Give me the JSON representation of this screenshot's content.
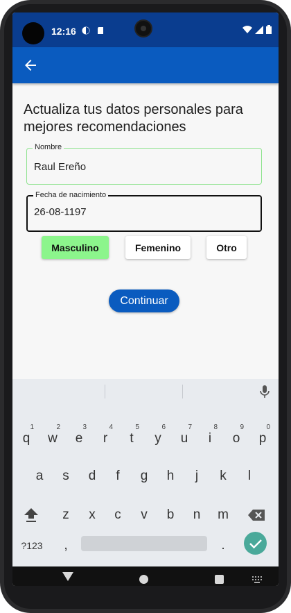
{
  "status": {
    "time": "12:16"
  },
  "header": {
    "back_icon": "arrow-back-icon"
  },
  "main": {
    "title": "Actualiza tus datos personales para mejores recomendaciones",
    "name_field": {
      "label": "Nombre",
      "value": "Raul Ereño"
    },
    "date_field": {
      "label": "Fecha de nacimiento",
      "value": "26-08-1197"
    },
    "gender_options": [
      "Masculino",
      "Femenino",
      "Otro"
    ],
    "selected_gender": "Masculino",
    "continue_label": "Continuar"
  },
  "keyboard": {
    "row1": [
      {
        "key": "q",
        "hint": "1"
      },
      {
        "key": "w",
        "hint": "2"
      },
      {
        "key": "e",
        "hint": "3"
      },
      {
        "key": "r",
        "hint": "4"
      },
      {
        "key": "t",
        "hint": "5"
      },
      {
        "key": "y",
        "hint": "6"
      },
      {
        "key": "u",
        "hint": "7"
      },
      {
        "key": "i",
        "hint": "8"
      },
      {
        "key": "o",
        "hint": "9"
      },
      {
        "key": "p",
        "hint": "0"
      }
    ],
    "row2": [
      "a",
      "s",
      "d",
      "f",
      "g",
      "h",
      "j",
      "k",
      "l"
    ],
    "row3": [
      "z",
      "x",
      "c",
      "v",
      "b",
      "n",
      "m"
    ],
    "symbols_label": "?123",
    "comma": ",",
    "period": "."
  },
  "colors": {
    "status_bar": "#0a3d8f",
    "app_bar": "#0a5bbf",
    "selected_chip": "#8cf58c",
    "name_border": "#8fe38f",
    "keyboard_ok": "#4aa99a"
  }
}
